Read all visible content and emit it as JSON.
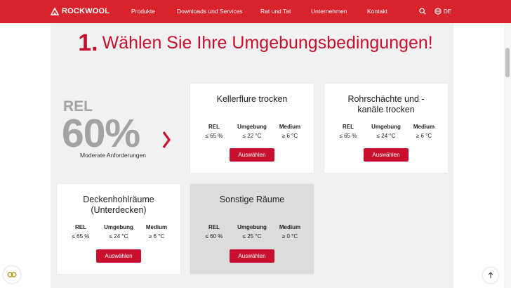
{
  "header": {
    "logo_text": "ROCKWOOL",
    "nav": [
      "Produkte",
      "Downloads und Services",
      "Rat und Tat",
      "Unternehmen",
      "Kontakt"
    ],
    "language": "DE",
    "background": "#d8232a"
  },
  "headline": {
    "number": "1.",
    "text": "Wählen Sie Ihre Umgebungsbedingungen!"
  },
  "current": {
    "label": "REL",
    "value": "60%",
    "description": "Moderate Anforderungen"
  },
  "stat_labels": {
    "rel": "REL",
    "env": "Umgebung",
    "medium": "Medium"
  },
  "button_label": "Auswählen",
  "cards": [
    {
      "title": "Kellerflure trocken",
      "rel": "≤ 65 %",
      "env": "≤ 22 °C",
      "medium": "≥ 6 °C",
      "selected": false
    },
    {
      "title": "Rohrschächte und - kanäle trocken",
      "rel": "≤ 65 %",
      "env": "≤ 24 °C",
      "medium": "≥ 6 °C",
      "selected": false
    },
    {
      "title": "Deckenhohlräume (Unterdecken)",
      "rel": "≤ 65 %",
      "env": "≤ 24 °C",
      "medium": "≥ 6 °C",
      "selected": false
    },
    {
      "title": "Sonstige Räume",
      "rel": "≤ 60 %",
      "env": "≤ 25 °C",
      "medium": "≥ 0 °C",
      "selected": true
    }
  ],
  "colors": {
    "accent": "#c8102e",
    "muted": "#a3a3a3"
  }
}
